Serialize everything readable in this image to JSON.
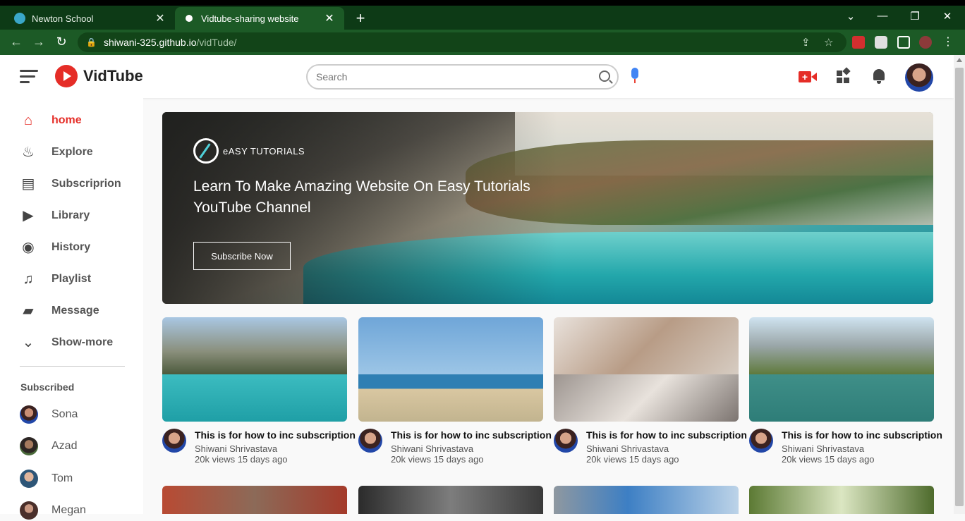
{
  "browser": {
    "tabs": [
      {
        "title": "Newton School",
        "active": false
      },
      {
        "title": "Vidtube-sharing website",
        "active": true
      }
    ],
    "url_host": "shiwani-325.github.io",
    "url_path": "/vidTude/"
  },
  "header": {
    "logo_text": "VidTube",
    "search_placeholder": "Search"
  },
  "sidebar": {
    "items": [
      {
        "label": "home",
        "icon": "home-icon",
        "active": true
      },
      {
        "label": "Explore",
        "icon": "explore-icon"
      },
      {
        "label": "Subscriprion",
        "icon": "subscription-icon"
      },
      {
        "label": "Library",
        "icon": "library-icon"
      },
      {
        "label": "History",
        "icon": "history-icon"
      },
      {
        "label": "Playlist",
        "icon": "playlist-icon"
      },
      {
        "label": "Message",
        "icon": "message-icon"
      },
      {
        "label": "Show-more",
        "icon": "chevron-down-icon"
      }
    ],
    "subscribed_heading": "Subscribed",
    "subscribed": [
      {
        "name": "Sona"
      },
      {
        "name": "Azad"
      },
      {
        "name": "Tom"
      },
      {
        "name": "Megan"
      }
    ]
  },
  "banner": {
    "brand": "eASY TUTORIALS",
    "headline": "Learn To Make Amazing Website On Easy Tutorials YouTube Channel",
    "button": "Subscribe Now"
  },
  "videos": [
    {
      "title": "This is for how to inc subscription",
      "author": "Shiwani Shrivastava",
      "meta": "20k views 15 days ago"
    },
    {
      "title": "This is for how to inc subscription",
      "author": "Shiwani Shrivastava",
      "meta": "20k views 15 days ago"
    },
    {
      "title": "This is for how to inc subscription",
      "author": "Shiwani Shrivastava",
      "meta": "20k views 15 days ago"
    },
    {
      "title": "This is for how to inc subscription",
      "author": "Shiwani Shrivastava",
      "meta": "20k views 15 days ago"
    }
  ],
  "colors": {
    "accent": "#e52d27",
    "browser_frame": "#1c5a26"
  }
}
